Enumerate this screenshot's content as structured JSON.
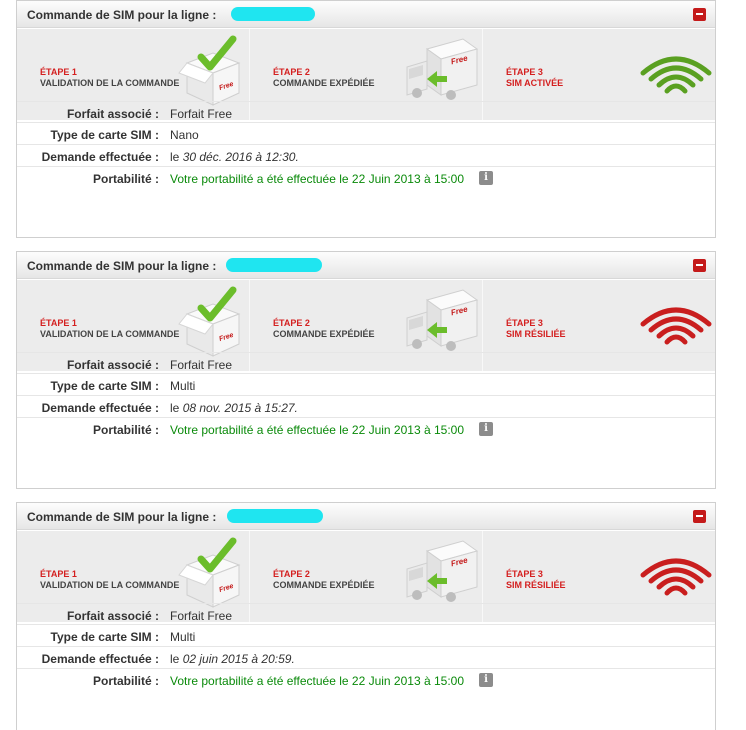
{
  "colors": {
    "accent_red": "#d41f1f",
    "wifi_green": "#5aa021",
    "wifi_red": "#c91e1e",
    "portability_green": "#0a8a0a",
    "redaction_cyan": "#1fe5f0"
  },
  "orders": [
    {
      "title": "Commande de SIM pour la ligne :",
      "steps": [
        {
          "num": "ÉTAPE 1",
          "label": "VALIDATION DE LA COMMANDE",
          "icon": "validation-box-check-icon"
        },
        {
          "num": "ÉTAPE 2",
          "label": "COMMANDE EXPÉDIÉE",
          "icon": "delivery-truck-icon"
        },
        {
          "num": "ÉTAPE 3",
          "label": "SIM ACTIVÉE",
          "icon": "wifi-signal-green-icon",
          "status": "active"
        }
      ],
      "rows": {
        "forfait_label": "Forfait associé :",
        "forfait_value": "Forfait Free",
        "type_label": "Type de carte SIM :",
        "type_value": "Nano",
        "demande_label": "Demande effectuée :",
        "demande_prefix": "le ",
        "demande_value": "30 déc. 2016 à 12:30.",
        "portabilite_label": "Portabilité :",
        "portabilite_value": "Votre portabilité a été effectuée le 22 Juin 2013 à 15:00"
      }
    },
    {
      "title": "Commande de SIM pour la ligne :",
      "steps": [
        {
          "num": "ÉTAPE 1",
          "label": "VALIDATION DE LA COMMANDE",
          "icon": "validation-box-check-icon"
        },
        {
          "num": "ÉTAPE 2",
          "label": "COMMANDE EXPÉDIÉE",
          "icon": "delivery-truck-icon"
        },
        {
          "num": "ÉTAPE 3",
          "label": "SIM RÉSILIÉE",
          "icon": "wifi-signal-red-icon",
          "status": "terminated"
        }
      ],
      "rows": {
        "forfait_label": "Forfait associé :",
        "forfait_value": "Forfait Free",
        "type_label": "Type de carte SIM :",
        "type_value": "Multi",
        "demande_label": "Demande effectuée :",
        "demande_prefix": "le ",
        "demande_value": "08 nov. 2015 à 15:27.",
        "portabilite_label": "Portabilité :",
        "portabilite_value": "Votre portabilité a été effectuée le 22 Juin 2013 à 15:00"
      }
    },
    {
      "title": "Commande de SIM pour la ligne :",
      "steps": [
        {
          "num": "ÉTAPE 1",
          "label": "VALIDATION DE LA COMMANDE",
          "icon": "validation-box-check-icon"
        },
        {
          "num": "ÉTAPE 2",
          "label": "COMMANDE EXPÉDIÉE",
          "icon": "delivery-truck-icon"
        },
        {
          "num": "ÉTAPE 3",
          "label": "SIM RÉSILIÉE",
          "icon": "wifi-signal-red-icon",
          "status": "terminated"
        }
      ],
      "rows": {
        "forfait_label": "Forfait associé :",
        "forfait_value": "Forfait Free",
        "type_label": "Type de carte SIM :",
        "type_value": "Multi",
        "demande_label": "Demande effectuée :",
        "demande_prefix": "le ",
        "demande_value": "02 juin 2015 à 20:59.",
        "portabilite_label": "Portabilité :",
        "portabilite_value": "Votre portabilité a été effectuée le 22 Juin 2013 à 15:00"
      }
    }
  ]
}
